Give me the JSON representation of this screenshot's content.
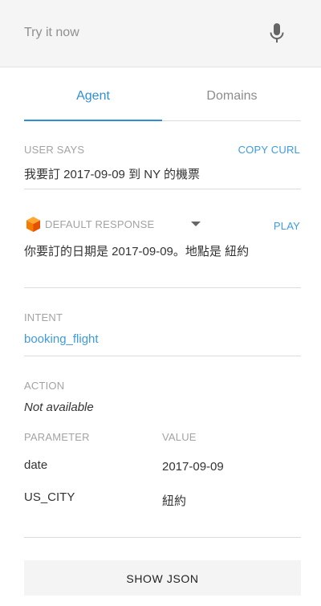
{
  "search": {
    "placeholder": "Try it now"
  },
  "tabs": [
    {
      "label": "Agent"
    },
    {
      "label": "Domains"
    }
  ],
  "user_says": {
    "label": "USER SAYS",
    "copy_curl": "COPY CURL",
    "text": "我要訂 2017-09-09 到 NY 的機票"
  },
  "response": {
    "label": "DEFAULT RESPONSE",
    "play": "PLAY",
    "text": "你要訂的日期是 2017-09-09。地點是 紐約"
  },
  "intent": {
    "label": "INTENT",
    "value": "booking_flight"
  },
  "action": {
    "label": "ACTION",
    "value": "Not available"
  },
  "parameters": {
    "header_parameter": "PARAMETER",
    "header_value": "VALUE",
    "rows": [
      {
        "name": "date",
        "value": "2017-09-09"
      },
      {
        "name": "US_CITY",
        "value": "紐約"
      }
    ]
  },
  "footer": {
    "show_json": "SHOW JSON"
  },
  "colors": {
    "accent": "#2f8fd6",
    "cube": "#f57c00"
  },
  "icons": [
    "microphone-icon",
    "cube-icon",
    "caret-down-icon"
  ]
}
